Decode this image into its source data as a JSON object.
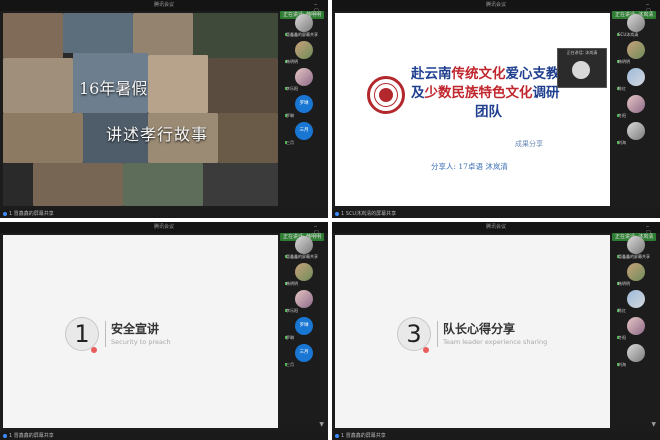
{
  "panels": [
    {
      "window_title": "腾讯会议",
      "share_tag": "正在讲话: 韩明明",
      "status": "1 冒鑫鑫的屏幕共享",
      "slide": {
        "line1": "16年暑假",
        "line2": "讲述孝行故事"
      },
      "participants": [
        {
          "name": "冒鑫鑫的屏幕共享",
          "initial": ""
        },
        {
          "name": "韩明明",
          "initial": ""
        },
        {
          "name": "李乐阳",
          "initial": ""
        },
        {
          "name": "罗琳",
          "initial": "罗琳"
        },
        {
          "name": "三月",
          "initial": "三月"
        }
      ]
    },
    {
      "window_title": "腾讯会议",
      "share_tag": "正在讲话: 沐岚清",
      "status": "1 SCU沐岚清的屏幕共享",
      "slide": {
        "title_part1_navy": "赴云南",
        "title_part1_red": "传统文化",
        "title_part1_navy2": "爱心支教",
        "title_part2_navy": "及",
        "title_part2_red": "少数民族特色文化",
        "title_part2_navy2": "调研",
        "title_part3": "团队",
        "outcome": "成果分享",
        "presenter": "分享人: 17卓语 沐岚清"
      },
      "self_view_label": "正在讲话: 沐岚清",
      "participants": [
        {
          "name": "SCU沐岚清",
          "initial": ""
        },
        {
          "name": "韩明明",
          "initial": ""
        },
        {
          "name": "陈红",
          "initial": ""
        },
        {
          "name": "冬阳",
          "initial": ""
        },
        {
          "name": "刘海",
          "initial": ""
        }
      ]
    },
    {
      "window_title": "腾讯会议",
      "share_tag": "正在讲话: 韩明明",
      "status": "1 冒鑫鑫的屏幕共享",
      "slide": {
        "number": "1",
        "heading": "安全宣讲",
        "subtitle": "Security to preach"
      },
      "participants": [
        {
          "name": "冒鑫鑫的屏幕共享",
          "initial": ""
        },
        {
          "name": "韩明明",
          "initial": ""
        },
        {
          "name": "李乐阳",
          "initial": ""
        },
        {
          "name": "罗琳",
          "initial": "罗琳"
        },
        {
          "name": "三月",
          "initial": "三月"
        }
      ]
    },
    {
      "window_title": "腾讯会议",
      "share_tag": "正在讲话: 沐岚清",
      "status": "1 冒鑫鑫的屏幕共享",
      "slide": {
        "number": "3",
        "heading": "队长心得分享",
        "subtitle": "Team leader experience sharing"
      },
      "participants": [
        {
          "name": "冒鑫鑫的屏幕共享",
          "initial": ""
        },
        {
          "name": "韩明明",
          "initial": ""
        },
        {
          "name": "陈红",
          "initial": ""
        },
        {
          "name": "冬阳",
          "initial": ""
        },
        {
          "name": "刘海",
          "initial": ""
        }
      ]
    }
  ]
}
